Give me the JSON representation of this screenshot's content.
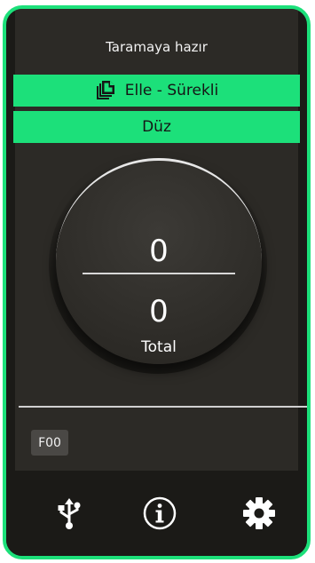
{
  "status": {
    "text": "Taramaya hazır"
  },
  "scan_mode": {
    "label": "Elle - Sürekli",
    "icon": "documents-icon"
  },
  "scan_type": {
    "label": "Düz"
  },
  "counter": {
    "current": "0",
    "total": "0",
    "total_label": "Total"
  },
  "error_code": {
    "label": "F00"
  },
  "toolbar": {
    "items": [
      {
        "icon": "usb-icon"
      },
      {
        "icon": "info-icon"
      },
      {
        "icon": "gear-icon"
      }
    ]
  },
  "colors": {
    "accent": "#1ce07a",
    "background": "#1b1a17",
    "panel": "#2c2a26",
    "text": "#ffffff"
  }
}
